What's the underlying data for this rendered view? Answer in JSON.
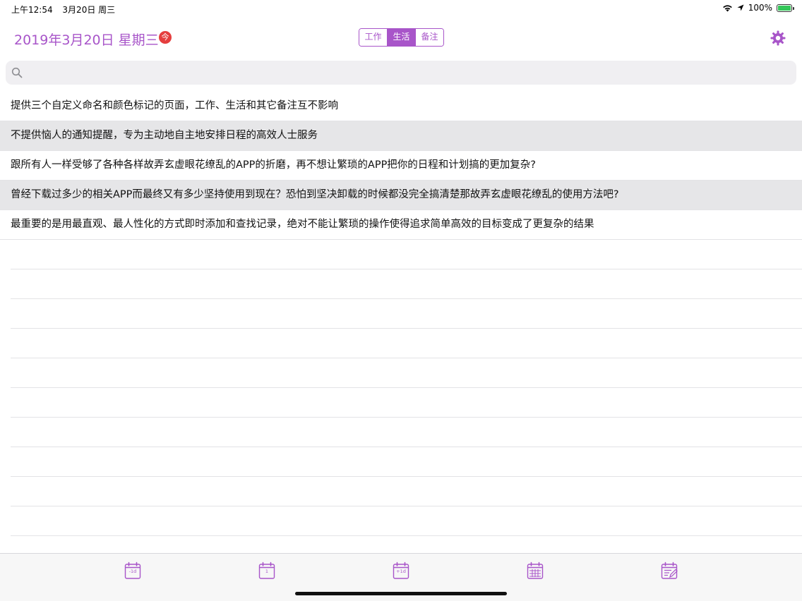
{
  "status_bar": {
    "time": "上午12:54",
    "date": "3月20日 周三",
    "battery": "100%",
    "battery_level": 1.0
  },
  "header": {
    "date_title": "2019年3月20日 星期三",
    "today_badge": "今",
    "tabs": [
      {
        "label": "工作",
        "active": false
      },
      {
        "label": "生活",
        "active": true
      },
      {
        "label": "备注",
        "active": false
      }
    ],
    "settings_icon": "gear-icon"
  },
  "search": {
    "placeholder": "",
    "value": "",
    "icon": "search-icon"
  },
  "notes": [
    "提供三个自定义命名和颜色标记的页面，工作、生活和其它备注互不影响",
    "不提供恼人的通知提醒，专为主动地自主地安排日程的高效人士服务",
    "跟所有人一样受够了各种各样故弄玄虚眼花缭乱的APP的折磨，再不想让繁琐的APP把你的日程和计划搞的更加复杂?",
    "曾经下载过多少的相关APP而最终又有多少坚持使用到现在？恐怕到坚决卸载的时候都没完全搞清楚那故弄玄虚眼花缭乱的使用方法吧?",
    "最重要的是用最直观、最人性化的方式即时添加和查找记录，绝对不能让繁琐的操作使得追求简单高效的目标变成了更复杂的结果"
  ],
  "toolbar": {
    "items": [
      {
        "name": "prev-day",
        "label": "-1d",
        "icon": "calendar-icon"
      },
      {
        "name": "today",
        "label": "1",
        "icon": "calendar-icon"
      },
      {
        "name": "next-day",
        "label": "+1d",
        "icon": "calendar-icon"
      },
      {
        "name": "month",
        "label": "",
        "icon": "calendar-grid-icon"
      },
      {
        "name": "edit",
        "label": "",
        "icon": "calendar-edit-icon"
      }
    ]
  },
  "colors": {
    "accent": "#a855c9",
    "badge": "#e53e3e",
    "row_shade": "#e6e6e8",
    "search_bg": "#f0eff2"
  }
}
